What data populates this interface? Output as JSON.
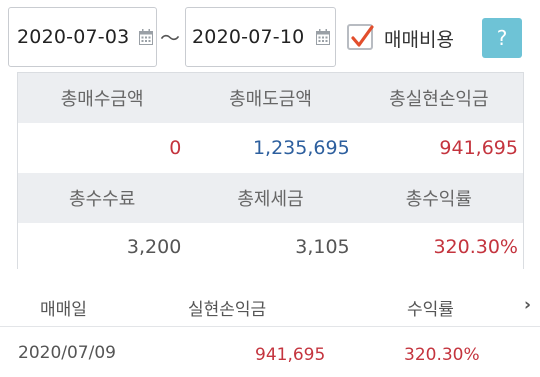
{
  "filter": {
    "date_from": "2020-07-03",
    "date_to": "2020-07-10",
    "separator": "～",
    "include_fee_checked": true,
    "include_fee_label": "매매비용",
    "help_label": "?"
  },
  "summary": {
    "row1_headers": [
      "총매수금액",
      "총매도금액",
      "총실현손익금"
    ],
    "row1_values": [
      "0",
      "1,235,695",
      "941,695"
    ],
    "row2_headers": [
      "총수수료",
      "총제세금",
      "총수익률"
    ],
    "row2_values": [
      "3,200",
      "3,105",
      "320.30%"
    ]
  },
  "list": {
    "columns": [
      "매매일",
      "실현손익금",
      "수익률"
    ],
    "rows": [
      {
        "date": "2020/07/09",
        "profit": "941,695",
        "rate": "320.30%"
      }
    ]
  },
  "colors": {
    "accent": "#6ec3d6",
    "check": "#e24e2c",
    "positive": "#c4343e",
    "neutral_blue": "#2d5f9e",
    "header_bg": "#eceef1"
  },
  "icons": [
    "calendar-icon",
    "checkmark-icon",
    "help-icon",
    "chevron-right-icon"
  ]
}
